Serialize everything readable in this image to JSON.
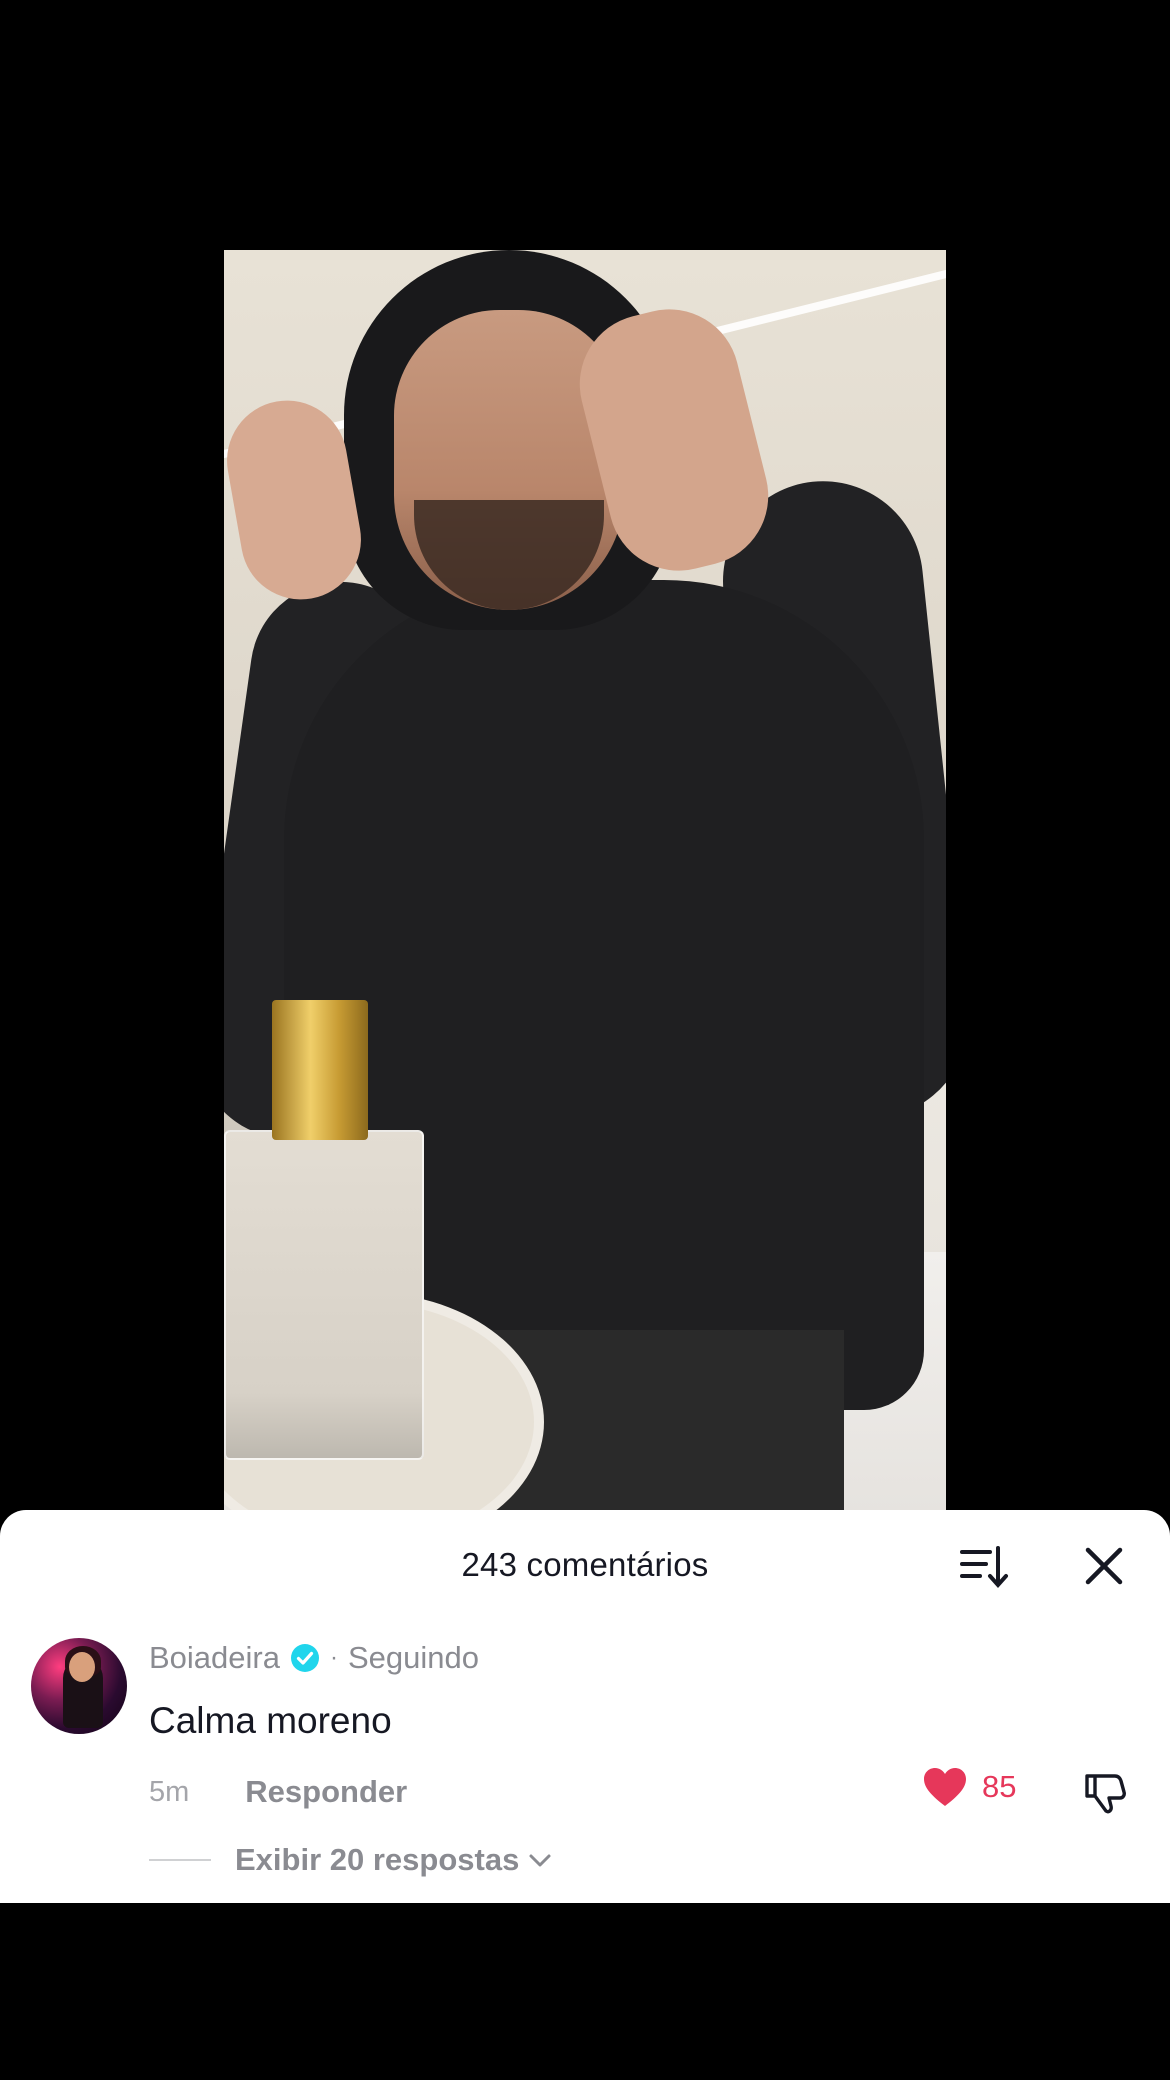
{
  "comments_sheet": {
    "title": "243 comentários",
    "sort_icon": "sort-icon",
    "close_icon": "close-icon"
  },
  "comment": {
    "username": "Boiadeira",
    "verified_icon": "verified-badge-icon",
    "separator": "·",
    "follow_status": "Seguindo",
    "text": "Calma moreno",
    "time": "5m",
    "reply_label": "Responder",
    "like_count": "85",
    "like_icon": "heart-filled-icon",
    "dislike_icon": "thumbs-down-icon",
    "view_replies": "Exibir 20 respostas",
    "chevron_icon": "chevron-down-icon"
  },
  "colors": {
    "accent_like": "#e6375a",
    "verified": "#20d5ec",
    "text_primary": "#161823",
    "text_secondary": "#8a8b91"
  }
}
